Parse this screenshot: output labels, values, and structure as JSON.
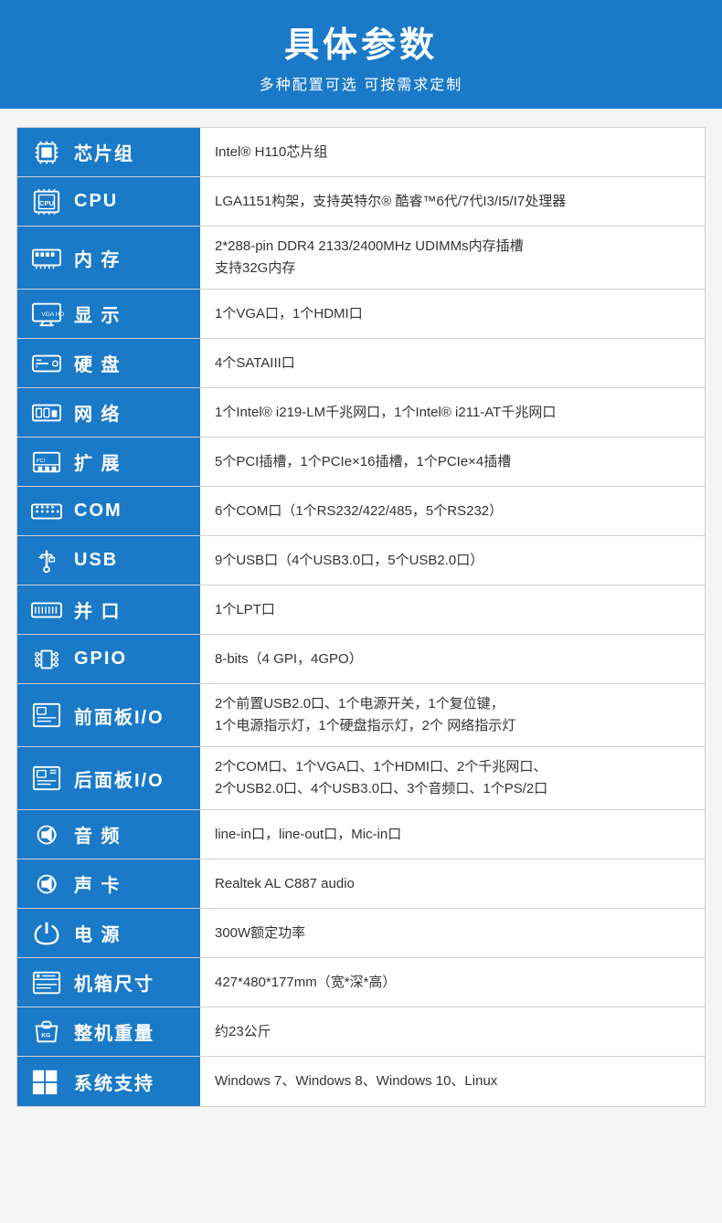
{
  "header": {
    "title": "具体参数",
    "subtitle": "多种配置可选 可按需求定制"
  },
  "specs": [
    {
      "id": "chipset",
      "label": "芯片组",
      "value": "Intel® H110芯片组",
      "icon": "chip"
    },
    {
      "id": "cpu",
      "label": "CPU",
      "value": "LGA1151构架，支持英特尔® 酷睿™6代/7代I3/I5/I7处理器",
      "icon": "cpu"
    },
    {
      "id": "ram",
      "label": "内 存",
      "value_lines": [
        "2*288-pin DDR4 2133/2400MHz UDIMMs内存插槽",
        "支持32G内存"
      ],
      "icon": "ram"
    },
    {
      "id": "display",
      "label": "显 示",
      "value": "1个VGA口，1个HDMI口",
      "icon": "display"
    },
    {
      "id": "hdd",
      "label": "硬 盘",
      "value": "4个SATAIII口",
      "icon": "hdd"
    },
    {
      "id": "network",
      "label": "网 络",
      "value": "1个Intel® i219-LM千兆网口，1个Intel® i211-AT千兆网口",
      "icon": "network"
    },
    {
      "id": "expand",
      "label": "扩 展",
      "value": "5个PCI插槽，1个PCIe×16插槽，1个PCIe×4插槽",
      "icon": "expand"
    },
    {
      "id": "com",
      "label": "COM",
      "value": "6个COM口（1个RS232/422/485，5个RS232）",
      "icon": "com"
    },
    {
      "id": "usb",
      "label": "USB",
      "value": "9个USB口（4个USB3.0口，5个USB2.0口）",
      "icon": "usb"
    },
    {
      "id": "parallel",
      "label": "并 口",
      "value": "1个LPT口",
      "icon": "parallel"
    },
    {
      "id": "gpio",
      "label": "GPIO",
      "value": "8-bits（4 GPI，4GPO）",
      "icon": "gpio"
    },
    {
      "id": "front_io",
      "label": "前面板I/O",
      "value_lines": [
        "2个前置USB2.0口、1个电源开关，1个复位键，",
        "1个电源指示灯，1个硬盘指示灯，2个 网络指示灯"
      ],
      "icon": "front"
    },
    {
      "id": "rear_io",
      "label": "后面板I/O",
      "value_lines": [
        "2个COM口、1个VGA口、1个HDMI口、2个千兆网口、",
        "2个USB2.0口、4个USB3.0口、3个音频口、1个PS/2口"
      ],
      "icon": "rear"
    },
    {
      "id": "audio",
      "label": "音 频",
      "value": "line-in口，line-out口，Mic-in口",
      "icon": "audio"
    },
    {
      "id": "soundcard",
      "label": "声 卡",
      "value": "Realtek AL C887 audio",
      "icon": "soundcard"
    },
    {
      "id": "power",
      "label": "电 源",
      "value": "300W额定功率",
      "icon": "power"
    },
    {
      "id": "case_size",
      "label": "机箱尺寸",
      "value": "427*480*177mm（宽*深*高）",
      "icon": "case"
    },
    {
      "id": "weight",
      "label": "整机重量",
      "value": "约23公斤",
      "icon": "weight"
    },
    {
      "id": "os",
      "label": "系统支持",
      "value": "Windows 7、Windows 8、Windows 10、Linux",
      "icon": "os"
    }
  ]
}
